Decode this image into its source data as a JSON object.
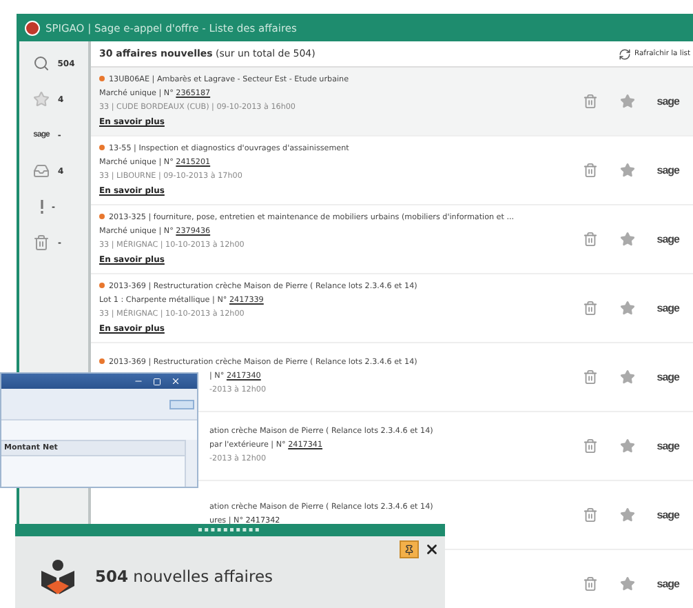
{
  "window": {
    "title": "SPIGAO | Sage e-appel d'offre - Liste des affaires"
  },
  "sidebar": {
    "items": [
      {
        "kind": "search",
        "count": "504"
      },
      {
        "kind": "star",
        "count": "4"
      },
      {
        "kind": "sage",
        "logo": "sage",
        "count": "-"
      },
      {
        "kind": "inbox",
        "count": "4"
      },
      {
        "kind": "alert",
        "count": "-"
      },
      {
        "kind": "trash",
        "count": "-"
      }
    ]
  },
  "header": {
    "summary": "**30 affaires nouvelles** (sur un total de 504)",
    "refresh": "Rafraîchir la list"
  },
  "rows": [
    {
      "kind": "full",
      "selected": true,
      "title": "13UB06AE | Ambarès et Lagrave - Secteur Est - Etude urbaine",
      "lot": "Marché unique | N° ",
      "number": "2365187",
      "place": "33 | CUDE BORDEAUX (CUB) | 09-10-2013 à 16h00",
      "more": "En savoir plus",
      "logo": "sage"
    },
    {
      "kind": "full",
      "selected": false,
      "title": "13-55 | Inspection et diagnostics d'ouvrages d'assainissement",
      "lot": "Marché unique | N° ",
      "number": "2415201",
      "place": "33 | LIBOURNE | 09-10-2013 à 17h00",
      "more": "En savoir plus",
      "logo": "sage"
    },
    {
      "kind": "full",
      "selected": false,
      "title": "2013-325 | fourniture, pose, entretien et maintenance de mobiliers urbains (mobiliers d'information et ...",
      "lot": "Marché unique | N° ",
      "number": "2379436",
      "place": "33 | MÉRIGNAC | 10-10-2013 à 12h00",
      "more": "En savoir plus",
      "logo": "sage"
    },
    {
      "kind": "full",
      "selected": false,
      "title": "2013-369 | Restructuration crèche Maison de Pierre ( Relance lots 2.3.4.6 et 14)",
      "lot": "Lot 1 : Charpente métallique | N° ",
      "number": "2417339",
      "place": "33 | MÉRIGNAC | 10-10-2013 à 12h00",
      "more": "En savoir plus",
      "logo": "sage"
    },
    {
      "kind": "partial",
      "selected": false,
      "title": "2013-369 | Restructuration crèche Maison de Pierre ( Relance lots 2.3.4.6 et 14)",
      "lot": "| N° ",
      "number": "2417340",
      "place": "-2013 à 12h00",
      "logo": "sage"
    },
    {
      "kind": "clipped",
      "selected": false,
      "title": "ation crèche Maison de Pierre ( Relance lots 2.3.4.6 et 14)",
      "lot": "par l'extérieure | N° ",
      "number": "2417341",
      "place": "-2013 à 12h00",
      "logo": "sage"
    },
    {
      "kind": "clipped",
      "selected": false,
      "title": "ation crèche Maison de Pierre ( Relance lots 2.3.4.6 et 14)",
      "lot": "ures | N° ",
      "number": "2417342",
      "logo": "sage"
    },
    {
      "kind": "clipped",
      "selected": false,
      "logo": "sage"
    }
  ],
  "back_window": {
    "column": "Montant Net"
  },
  "notification": {
    "message": "**504** nouvelles affaires"
  }
}
